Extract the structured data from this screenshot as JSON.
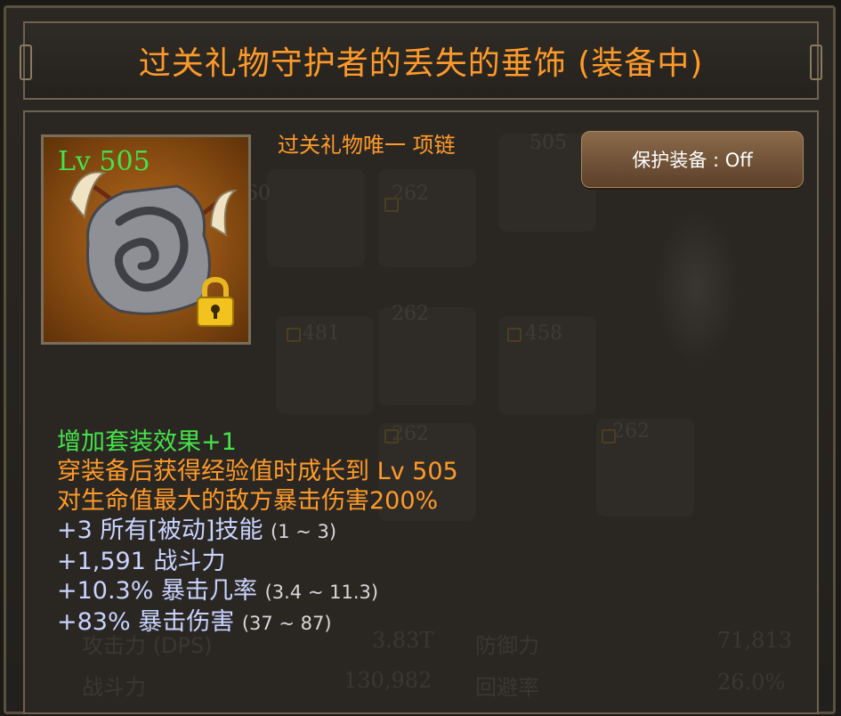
{
  "header": {
    "title": "过关礼物守护者的丢失的垂饰 (装备中)"
  },
  "item": {
    "level_label": "Lv 505",
    "type_label": "过关礼物唯一 项链",
    "locked": true
  },
  "protect_button": {
    "label": "保护装备 : Off"
  },
  "effects": {
    "set_bonus": "增加套装效果+1",
    "growth": "穿装备后获得经验值时成长到 Lv 505",
    "damage": "对生命值最大的敌方暴击伤害200%"
  },
  "options": [
    {
      "value": "+3 所有[被动]技能",
      "range": "(1 ~ 3)"
    },
    {
      "value": "+1,591 战斗力",
      "range": ""
    },
    {
      "value": "+10.3% 暴击几率",
      "range": "(3.4 ~ 11.3)"
    },
    {
      "value": "+83% 暴击伤害",
      "range": "(37 ~ 87)"
    }
  ],
  "background": {
    "slot_levels": [
      "260",
      "262",
      "505",
      "481",
      "262",
      "458",
      "262",
      "262"
    ],
    "stats": {
      "attack_label": "攻击力 (DPS)",
      "attack_value": "3.83T",
      "defense_label": "防御力",
      "defense_value": "71,813",
      "power_label": "战斗力",
      "power_value": "130,982",
      "evade_label": "回避率",
      "evade_value": "26.0%"
    }
  },
  "colors": {
    "title": "#ff9a2a",
    "level": "#46e24a",
    "option": "#c9d3ff"
  }
}
